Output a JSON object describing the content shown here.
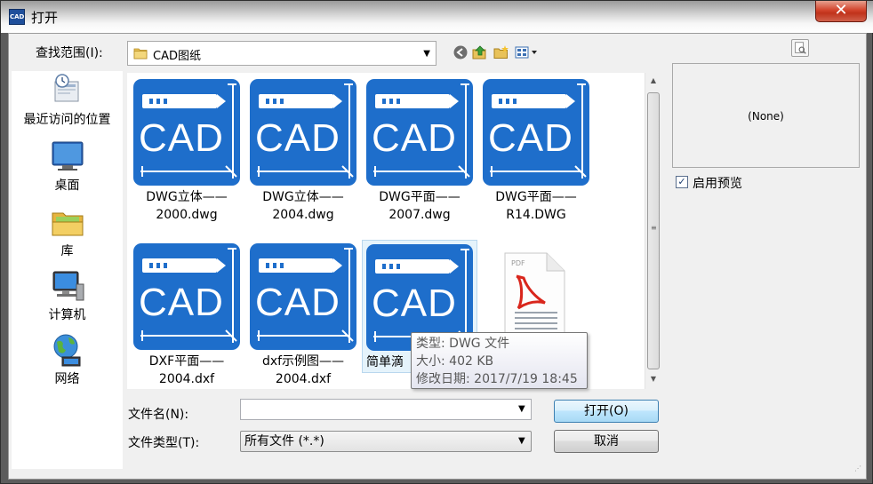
{
  "window": {
    "title": "打开",
    "close_label": "✕",
    "app_icon_text": "CAD"
  },
  "toolbar": {
    "lookin_label": "查找范围(I):",
    "lookin_value": "CAD图纸"
  },
  "places": [
    {
      "label": "最近访问的位置"
    },
    {
      "label": "桌面"
    },
    {
      "label": "库"
    },
    {
      "label": "计算机"
    },
    {
      "label": "网络"
    }
  ],
  "files": [
    {
      "name": "DWG立体——\n2000.dwg",
      "icon": "cad-file-icon"
    },
    {
      "name": "DWG立体——\n2004.dwg",
      "icon": "cad-file-icon"
    },
    {
      "name": "DWG平面——\n2007.dwg",
      "icon": "cad-file-icon"
    },
    {
      "name": "DWG平面——\nR14.DWG",
      "icon": "cad-file-icon"
    },
    {
      "name": "DXF平面——\n2004.dxf",
      "icon": "cad-file-icon"
    },
    {
      "name": "dxf示例图——\n2004.dxf",
      "icon": "cad-file-icon"
    },
    {
      "name": "简单滴",
      "icon": "cad-file-icon"
    },
    {
      "name": "",
      "icon": "pdf-file-icon"
    }
  ],
  "cad_label": "CAD",
  "pdf_label": "PDF",
  "tooltip": {
    "type": "类型: DWG 文件",
    "size": "大小: 402 KB",
    "modified": "修改日期: 2017/7/19 18:45"
  },
  "preview": {
    "none_text": "(None)",
    "checkbox_label": "启用预览",
    "checked": true
  },
  "filename": {
    "label": "文件名(N):",
    "value": ""
  },
  "filetype": {
    "label": "文件类型(T):",
    "value": "所有文件 (*.*)"
  },
  "buttons": {
    "open": "打开(O)",
    "cancel": "取消"
  },
  "colors": {
    "cad_tile": "#1e6ecb",
    "close_button": "#c83a24",
    "title_bar": "#d8d8d8"
  }
}
